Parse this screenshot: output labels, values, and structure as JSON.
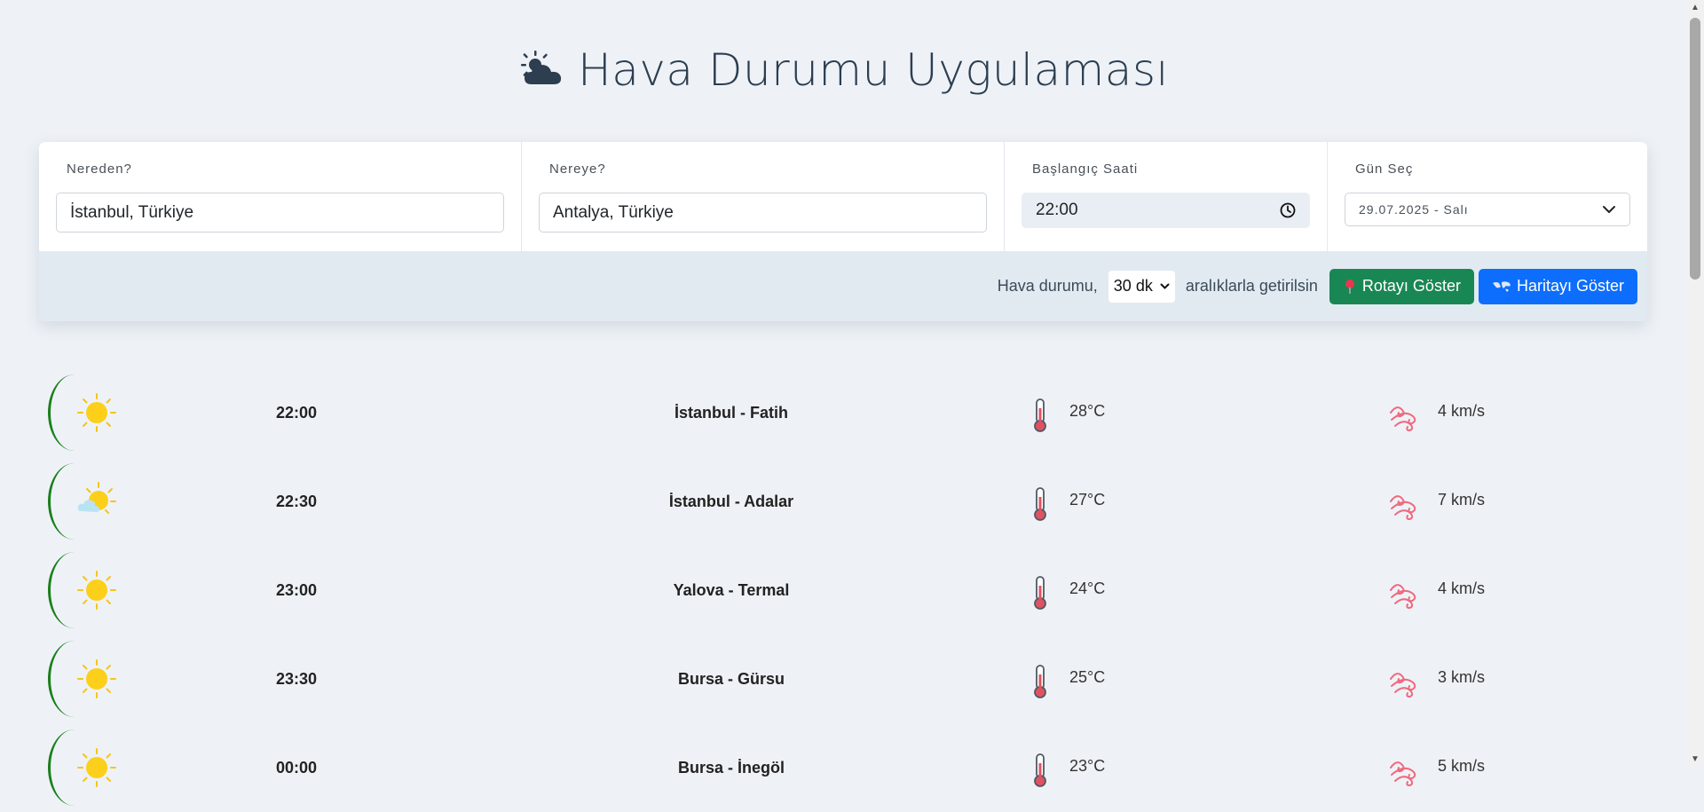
{
  "app": {
    "title": "Hava Durumu Uygulaması",
    "title_icon": "sun-behind-cloud-icon"
  },
  "form": {
    "from": {
      "label": "Nereden?",
      "value": "İstanbul, Türkiye"
    },
    "to": {
      "label": "Nereye?",
      "value": "Antalya, Türkiye"
    },
    "start_time": {
      "label": "Başlangıç Saati",
      "value": "22:00"
    },
    "day": {
      "label": "Gün Seç",
      "value": "29.07.2025 - Salı"
    }
  },
  "toolbar": {
    "prefix": "Hava durumu,",
    "interval_value": "30 dk",
    "suffix": "aralıklarla getirilsin",
    "route_button": "Rotayı Göster",
    "map_button": "Haritayı Göster"
  },
  "forecast": [
    {
      "icon": "sun-icon",
      "time": "22:00",
      "place": "İstanbul - Fatih",
      "temp": "28°C",
      "wind": "4 km/s"
    },
    {
      "icon": "sun-behind-cloud-icon",
      "time": "22:30",
      "place": "İstanbul - Adalar",
      "temp": "27°C",
      "wind": "7 km/s"
    },
    {
      "icon": "sun-icon",
      "time": "23:00",
      "place": "Yalova - Termal",
      "temp": "24°C",
      "wind": "4 km/s"
    },
    {
      "icon": "sun-icon",
      "time": "23:30",
      "place": "Bursa - Gürsu",
      "temp": "25°C",
      "wind": "3 km/s"
    },
    {
      "icon": "sun-icon",
      "time": "00:00",
      "place": "Bursa - İnegöl",
      "temp": "23°C",
      "wind": "5 km/s"
    }
  ]
}
